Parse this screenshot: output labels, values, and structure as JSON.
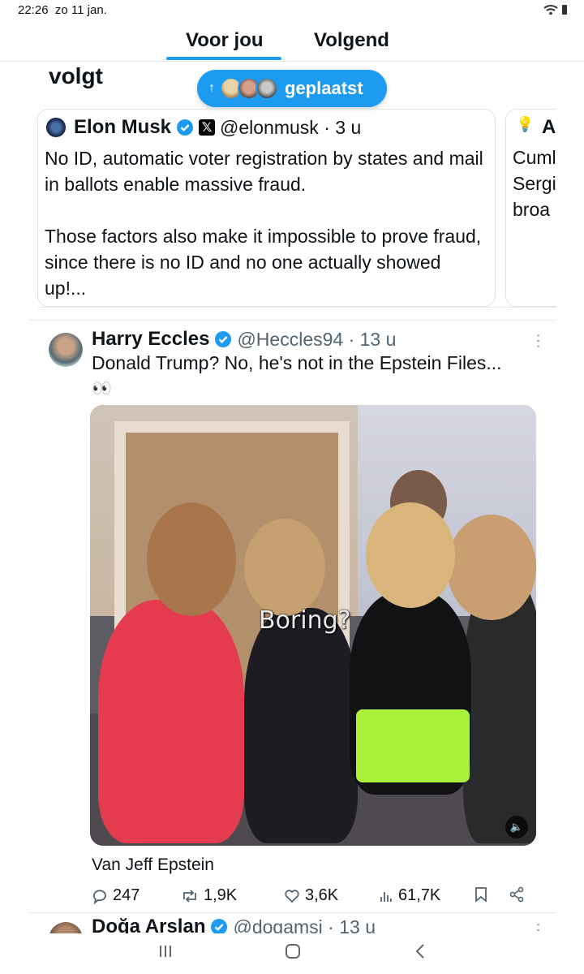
{
  "status": {
    "time": "22:26",
    "date": "zo 11 jan."
  },
  "tabs": [
    {
      "label": "Voor jou",
      "active": true
    },
    {
      "label": "Volgend",
      "active": false
    }
  ],
  "accent_color": "#1d9bf0",
  "section_label": "volgt",
  "posted_pill": {
    "label": "geplaatst",
    "icon": "arrow-up-icon"
  },
  "quote": {
    "name": "Elon Musk",
    "handle": "@elonmusk",
    "time": "3 u",
    "paragraphs": [
      "No ID, automatic voter registration by states and mail in ballots enable massive fraud.",
      "Those factors also make it impossible to prove fraud, since there is no ID and no one actually showed up!..."
    ]
  },
  "quote2": {
    "letter": "A",
    "lines": [
      "Cuml",
      "Sergi",
      "broa"
    ]
  },
  "tweet": {
    "name": "Harry Eccles",
    "handle": "@Heccles94",
    "time": "13 u",
    "text": "Donald Trump? No, he's not in the Epstein Files...",
    "emoji": "👀",
    "media_caption": "Boring?",
    "attribution": "Van Jeff Epstein",
    "replies": "247",
    "reposts": "1,9K",
    "likes": "3,6K",
    "views": "61,7K"
  },
  "next_tweet": {
    "name": "Doğa Arslan",
    "handle": "@dogamsi",
    "time": "13 u"
  }
}
